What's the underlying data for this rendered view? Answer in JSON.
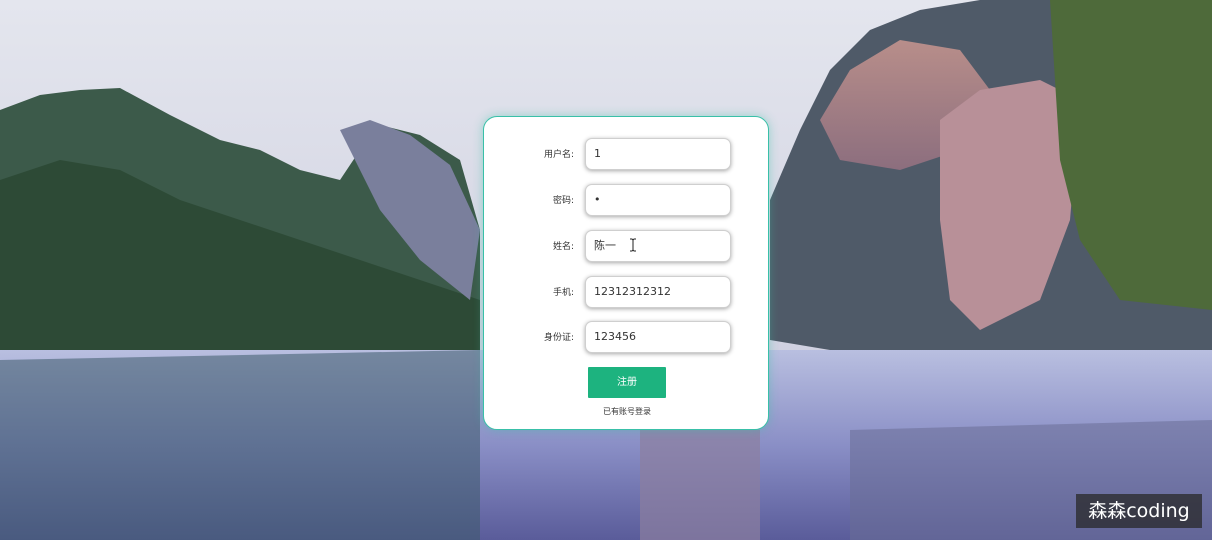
{
  "form": {
    "username": {
      "label": "用户名:",
      "value": "1"
    },
    "password": {
      "label": "密码:",
      "value": "•"
    },
    "name": {
      "label": "姓名:",
      "value": "陈一"
    },
    "phone": {
      "label": "手机:",
      "value": "12312312312"
    },
    "id_card": {
      "label": "身份证:",
      "value": "123456"
    },
    "register_label": "注册",
    "login_link": "已有账号登录"
  },
  "watermark": "森森coding",
  "colors": {
    "accent": "#1db37f",
    "card_border": "#39c0a8",
    "card_bg": "#ffffff"
  }
}
